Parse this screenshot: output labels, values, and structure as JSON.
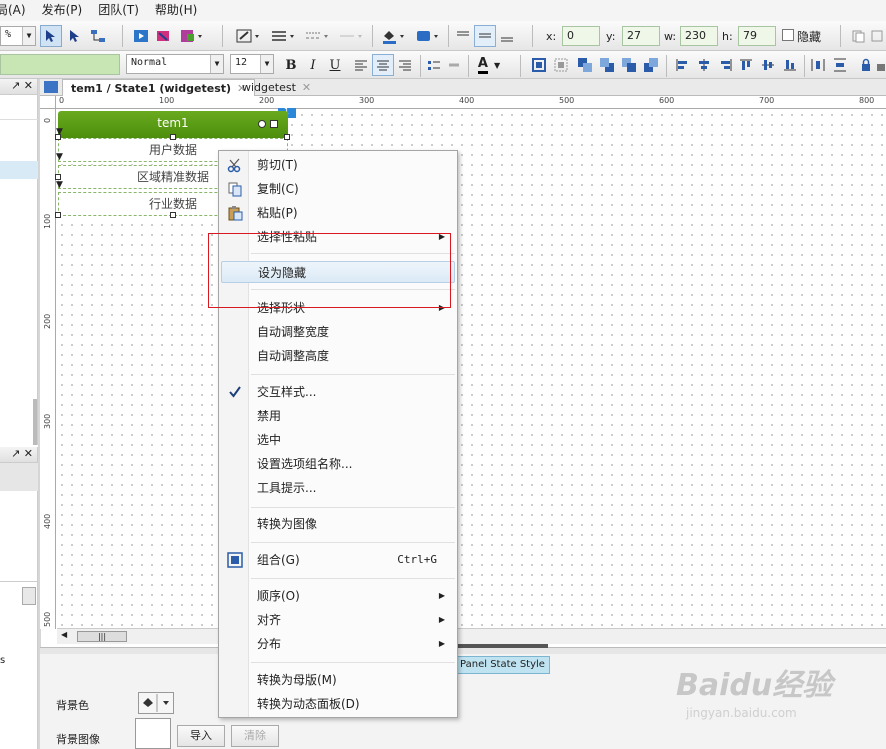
{
  "menubar": [
    "局(A)",
    "发布(P)",
    "团队(T)",
    "帮助(H)"
  ],
  "toolbar1": {
    "zoom": "%",
    "x_label": "x:",
    "x_value": "0",
    "y_label": "y:",
    "y_value": "27",
    "w_label": "w:",
    "w_value": "230",
    "h_label": "h:",
    "h_value": "79",
    "hidden_label": "隐藏"
  },
  "toolbar2": {
    "style_value": "Normal",
    "font_size": "12",
    "bold": "B",
    "italic": "I",
    "underline": "U",
    "font_color": "A"
  },
  "tabs": [
    {
      "label": "tem1 / State1 (widgetest)",
      "close": "✕"
    },
    {
      "label": "widgetest",
      "close": "✕"
    }
  ],
  "hruler": [
    "0",
    "100",
    "200",
    "300",
    "400",
    "500",
    "600",
    "700",
    "800"
  ],
  "vruler": [
    "0",
    "100",
    "200",
    "300",
    "400",
    "500"
  ],
  "widget": {
    "title": "tem1",
    "items": [
      "用户数据",
      "区域精准数据",
      "行业数据"
    ],
    "corner": "1"
  },
  "context_menu": [
    {
      "label": "剪切(T)",
      "icon": "scissors-icon"
    },
    {
      "label": "复制(C)",
      "icon": "copy-icon"
    },
    {
      "label": "粘贴(P)",
      "icon": "paste-icon"
    },
    {
      "label": "选择性粘贴",
      "submenu": "▶"
    },
    {
      "label": "设为隐藏"
    },
    {
      "label": "选择形状",
      "submenu": "▶"
    },
    {
      "label": "自动调整宽度"
    },
    {
      "label": "自动调整高度"
    },
    {
      "label": "交互样式...",
      "icon": "check-icon"
    },
    {
      "label": "禁用"
    },
    {
      "label": "选中"
    },
    {
      "label": "设置选项组名称..."
    },
    {
      "label": "工具提示..."
    },
    {
      "label": "转换为图像"
    },
    {
      "label": "组合(G)",
      "icon": "group-icon",
      "shortcut": "Ctrl+G"
    },
    {
      "label": "顺序(O)",
      "submenu": "▶"
    },
    {
      "label": "对齐",
      "submenu": "▶"
    },
    {
      "label": "分布",
      "submenu": "▶"
    },
    {
      "label": "转换为母版(M)"
    },
    {
      "label": "转换为动态面板(D)"
    }
  ],
  "bottom": {
    "panel_state_style": "Panel State Style",
    "bg_color_label": "背景色",
    "bg_image_label": "背景图像",
    "import_button": "导入",
    "clear_button": "清除",
    "left_cut_label": "s"
  },
  "scroll_thumb": "|||",
  "watermark": "Baidu经验",
  "watermark_url": "jingyan.baidu.com",
  "colors": {
    "widget_header": "#5a9c15",
    "highlight_box": "#d9191f",
    "panel_state": "#bfe3f1"
  }
}
